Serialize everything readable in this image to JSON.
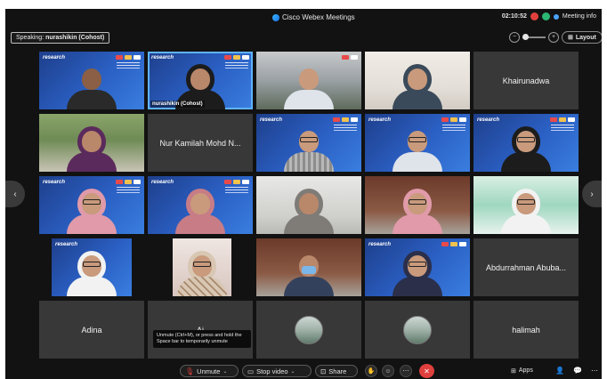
{
  "app": {
    "title": "Cisco Webex Meetings",
    "clock": "02:10:52",
    "meeting_info": "Meeting info"
  },
  "speaking": {
    "prefix": "Speaking:",
    "name": "nurashikin (Cohost)"
  },
  "layout_label": "Layout",
  "brand": "research",
  "participants": [
    {
      "label": ""
    },
    {
      "label": "nurashikin (Cohost)"
    },
    {
      "label": ""
    },
    {
      "label": ""
    },
    {
      "label": "Khairunadwa"
    },
    {
      "label": ""
    },
    {
      "label": "Nur Kamilah Mohd N..."
    },
    {
      "label": ""
    },
    {
      "label": ""
    },
    {
      "label": ""
    },
    {
      "label": ""
    },
    {
      "label": ""
    },
    {
      "label": ""
    },
    {
      "label": ""
    },
    {
      "label": ""
    },
    {
      "label": ""
    },
    {
      "label": ""
    },
    {
      "label": ""
    },
    {
      "label": ""
    },
    {
      "label": "Abdurrahman Abuba..."
    },
    {
      "label": "Adina"
    },
    {
      "label": "Ai"
    },
    {
      "label": ""
    },
    {
      "label": ""
    },
    {
      "label": "halimah"
    }
  ],
  "tooltip": "Unmute (Ctrl+M), or press and hold the Space bar to temporarily unmute",
  "toolbar": {
    "unmute": "Unmute",
    "stop_video": "Stop video",
    "share": "Share",
    "apps": "Apps"
  }
}
